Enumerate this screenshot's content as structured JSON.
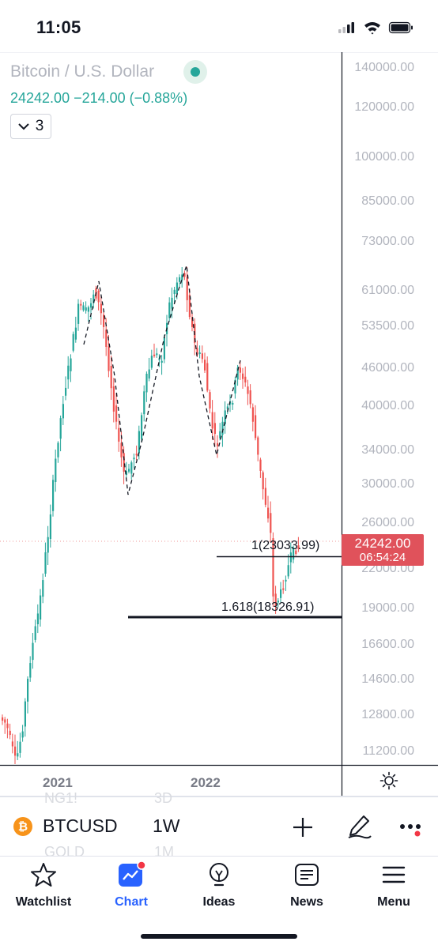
{
  "status_bar": {
    "time": "11:05"
  },
  "header": {
    "symbol_title": "Bitcoin / U.S. Dollar",
    "price_line": "24242.00  −214.00 (−0.88%)",
    "indicator_count": "3",
    "live_color": "#26a69a"
  },
  "price_axis": {
    "labels": [
      "140000.00",
      "120000.00",
      "100000.00",
      "85000.00",
      "73000.00",
      "61000.00",
      "53500.00",
      "46000.00",
      "40000.00",
      "34000.00",
      "30000.00",
      "26000.00",
      "22000.00",
      "19000.00",
      "16600.00",
      "14600.00",
      "12800.00",
      "11200.00"
    ]
  },
  "price_tag": {
    "price": "24242.00",
    "countdown": "06:54:24",
    "color": "#e0525b"
  },
  "fib_levels": [
    {
      "label": "1(23033.99)"
    },
    {
      "label": "1.618(18326.91)"
    }
  ],
  "time_axis": {
    "labels": [
      "2021",
      "2022"
    ]
  },
  "chart_data": {
    "type": "candlestick",
    "symbol": "BTCUSD",
    "interval": "1W",
    "log_scale": true,
    "colors": {
      "up": "#26a69a",
      "down": "#ef5350"
    },
    "pivots_approx": [
      {
        "label": "2021 high",
        "close": 63000
      },
      {
        "label": "mid-2021 low",
        "close": 29000
      },
      {
        "label": "Nov 2021 ATH",
        "close": 69000
      },
      {
        "label": "early 2022 low",
        "close": 33000
      },
      {
        "label": "spring 2022 high",
        "close": 48000
      },
      {
        "label": "June 2022 low",
        "close": 17600
      },
      {
        "label": "last",
        "close": 24242
      }
    ]
  },
  "symbol_bar": {
    "icon_glyph": "₿",
    "symbol": "BTCUSD",
    "interval": "1W",
    "ghost_above": [
      "NG1!",
      "3D"
    ],
    "ghost_below": [
      "GOLD",
      "1M"
    ]
  },
  "tabs": [
    {
      "label": "Watchlist",
      "icon": "star-icon"
    },
    {
      "label": "Chart",
      "icon": "chart-icon",
      "active": true
    },
    {
      "label": "Ideas",
      "icon": "lightbulb-icon"
    },
    {
      "label": "News",
      "icon": "news-icon"
    },
    {
      "label": "Menu",
      "icon": "menu-icon"
    }
  ],
  "accent_color": "#2962ff"
}
